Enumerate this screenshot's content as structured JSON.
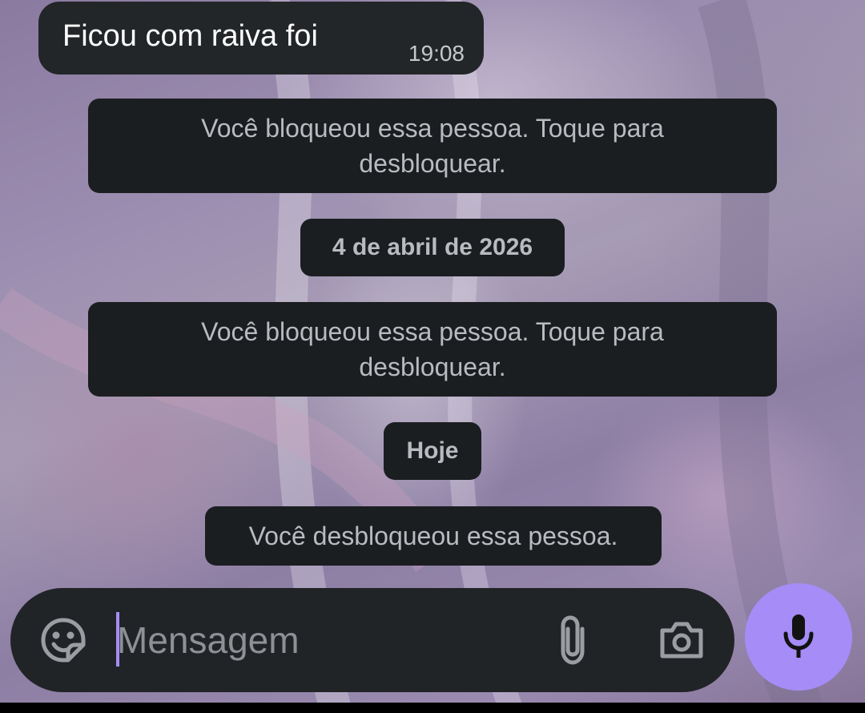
{
  "messages": {
    "incoming": {
      "text": "Ficou com raiva foi",
      "time": "19:08"
    },
    "system_blocked_1": "Você bloqueou essa pessoa. Toque para desbloquear.",
    "date_divider": "4 de abril de 2026",
    "system_blocked_2": "Você bloqueou essa pessoa. Toque para desbloquear.",
    "today_divider": "Hoje",
    "system_unblocked": "Você desbloqueou essa pessoa."
  },
  "composer": {
    "placeholder": "Mensagem",
    "value": "",
    "icons": {
      "emoji": "sticker-emoji-icon",
      "attach": "paperclip-icon",
      "camera": "camera-icon",
      "mic": "microphone-icon"
    }
  },
  "colors": {
    "accent": "#a58cf6",
    "bubble": "#232629",
    "system_bubble": "#1b1e21",
    "composer": "#212427"
  }
}
